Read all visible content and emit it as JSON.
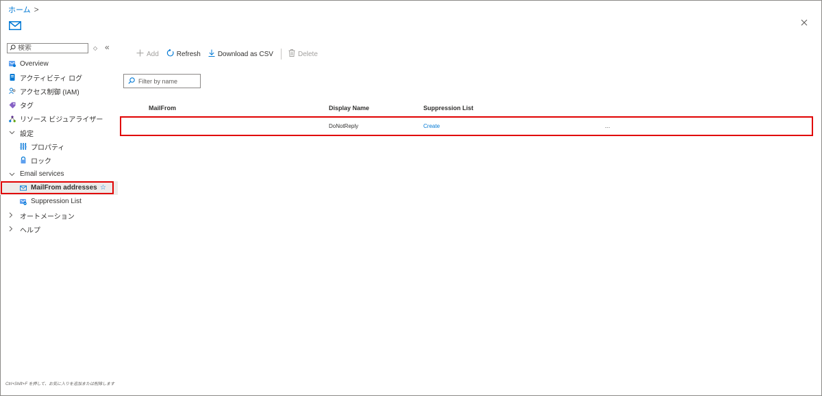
{
  "breadcrumb": {
    "home": "ホーム",
    "sep": ">"
  },
  "sidebar": {
    "search_placeholder": "検索",
    "sort_label": "◇",
    "collapse_label": "«",
    "items": [
      {
        "label": "Overview",
        "icon": "overview-icon"
      },
      {
        "label": "アクティビティ ログ",
        "icon": "activity-log-icon"
      },
      {
        "label": "アクセス制御 (IAM)",
        "icon": "iam-icon"
      },
      {
        "label": "タグ",
        "icon": "tag-icon"
      },
      {
        "label": "リソース ビジュアライザー",
        "icon": "resource-visualizer-icon"
      },
      {
        "label": "設定",
        "icon": "chevron-down-icon"
      },
      {
        "label": "プロパティ",
        "icon": "properties-icon"
      },
      {
        "label": "ロック",
        "icon": "lock-icon"
      },
      {
        "label": "Email services",
        "icon": "chevron-down-icon"
      },
      {
        "label": "MailFrom addresses",
        "icon": "mail-icon"
      },
      {
        "label": "Suppression List",
        "icon": "suppression-list-icon"
      },
      {
        "label": "オートメーション",
        "icon": "chevron-right-icon"
      },
      {
        "label": "ヘルプ",
        "icon": "chevron-right-icon"
      }
    ],
    "footer_hint": "Ctrl+Shift+F を押して、お気に入りを追加または削除します"
  },
  "toolbar": {
    "add": "Add",
    "refresh": "Refresh",
    "download": "Download as CSV",
    "delete": "Delete"
  },
  "filter": {
    "placeholder": "Filter by name"
  },
  "table": {
    "headers": {
      "mailfrom": "MailFrom",
      "display_name": "Display Name",
      "suppression": "Suppression List"
    },
    "rows": [
      {
        "mailfrom": "",
        "display_name": "DoNotReply",
        "suppression": "Create",
        "more": "..."
      }
    ]
  },
  "colors": {
    "accent": "#0078d4",
    "highlight": "#e00000",
    "text": "#323130"
  }
}
